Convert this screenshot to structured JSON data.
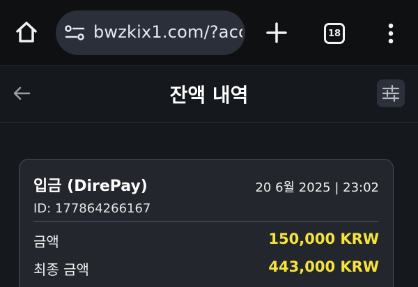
{
  "browser": {
    "url": "bwzkix1.com/?acc",
    "tab_count": "18"
  },
  "header": {
    "title": "잔액 내역"
  },
  "transaction": {
    "title": "입금 (DirePay)",
    "datetime": "20 6월 2025 | 23:02",
    "id_text": "ID: 177864266167",
    "amount_label": "금액",
    "amount_value": "150,000 KRW",
    "final_label": "최종 금액",
    "final_value": "443,000 KRW"
  },
  "colors": {
    "amount_highlight": "#f7e43a",
    "background": "#15181c",
    "card": "#23262c"
  },
  "icons": [
    "home-icon",
    "site-settings-icon",
    "plus-icon",
    "tabs-icon",
    "more-vert-icon",
    "back-arrow-icon",
    "filter-sliders-icon"
  ]
}
